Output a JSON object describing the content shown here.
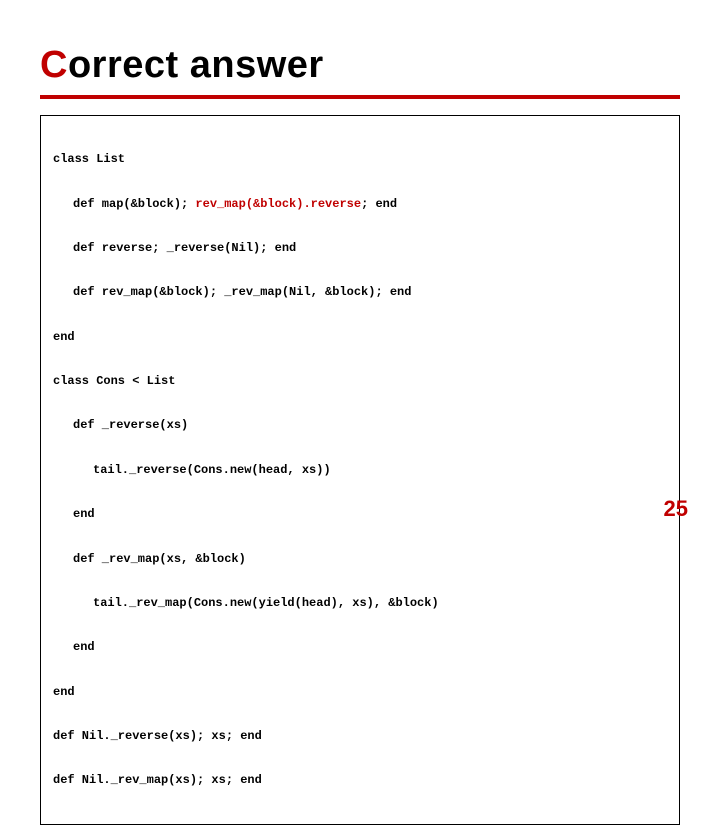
{
  "title_accent": "C",
  "title_rest": "orrect answer",
  "code": {
    "l0": "class List",
    "l1a": "def map(&block); ",
    "l1b": "rev_map(&block).reverse",
    "l1c": "; end",
    "l2": "def reverse; _reverse(Nil); end",
    "l3": "def rev_map(&block); _rev_map(Nil, &block); end",
    "l4": "end",
    "l5": "class Cons < List",
    "l6": "def _reverse(xs)",
    "l7": "tail._reverse(Cons.new(head, xs))",
    "l8": "end",
    "l9": "def _rev_map(xs, &block)",
    "l10": "tail._rev_map(Cons.new(yield(head), xs), &block)",
    "l11": "end",
    "l12": "end",
    "l13": "def Nil._reverse(xs); xs; end",
    "l14": "def Nil._rev_map(xs); xs; end"
  },
  "page_number": "25"
}
